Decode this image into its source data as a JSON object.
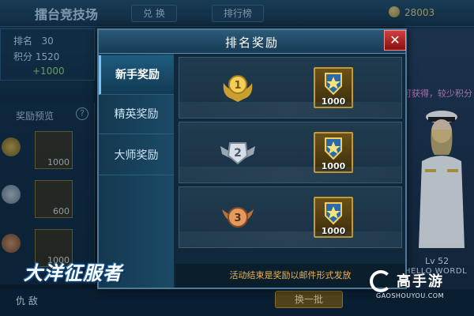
{
  "background": {
    "header_title": "擂台竞技场",
    "tabs": [
      "兑 换",
      "排行榜"
    ],
    "coins": "28003",
    "rank_label": "排名",
    "rank_value": "30",
    "score_label": "积分",
    "score_value": "1520",
    "score_delta": "+1000",
    "preview_label": "奖励预览",
    "preview_help": "?",
    "preview_counts": [
      "1000",
      "600",
      "1000"
    ],
    "right_hint": "可获得，较少积分",
    "level": "Lv 52",
    "player_name": "HELLO WORDL",
    "bottom_left": "仇 敌",
    "bottom_button": "换一批"
  },
  "logo": {
    "game_name": "大洋征服者"
  },
  "watermark": {
    "site_name": "高手游",
    "url": "GAOSHOUYOU.COM"
  },
  "modal": {
    "title": "排名奖励",
    "close_label": "✕",
    "tabs": [
      {
        "label": "新手奖励",
        "active": true
      },
      {
        "label": "精英奖励",
        "active": false
      },
      {
        "label": "大师奖励",
        "active": false
      }
    ],
    "rows": [
      {
        "rank": "1",
        "reward_count": "1000"
      },
      {
        "rank": "2",
        "reward_count": "1000"
      },
      {
        "rank": "3",
        "reward_count": "1000"
      }
    ],
    "footer_text": "活动结束是奖励以邮件形式发放"
  },
  "colors": {
    "gold": "#c79a30",
    "silver": "#c0c8d0",
    "bronze": "#d08a50",
    "notice": "#f3b24a",
    "close": "#c02828"
  }
}
